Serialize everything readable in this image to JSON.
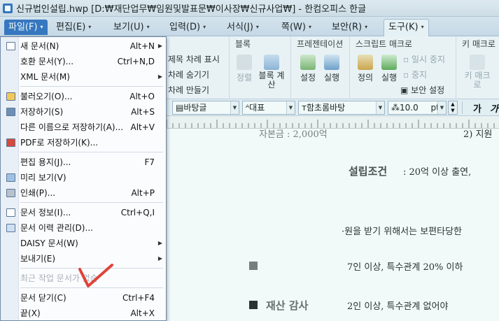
{
  "window": {
    "title": "신규법인설립.hwp [D:₩재단업무₩임원및발표문₩이사장₩신규사업₩] - 한컴오피스 한글"
  },
  "menubar": {
    "items": [
      {
        "label": "파일(F)",
        "arrow": "▾"
      },
      {
        "label": "편집(E)",
        "arrow": "▾"
      },
      {
        "label": "보기(U)",
        "arrow": "▾"
      },
      {
        "label": "입력(D)",
        "arrow": "▾"
      },
      {
        "label": "서식(J)",
        "arrow": "▾"
      },
      {
        "label": "쪽(W)",
        "arrow": "▾"
      },
      {
        "label": "보안(R)",
        "arrow": "▾"
      },
      {
        "label": "도구(K)",
        "arrow": "▾"
      }
    ]
  },
  "ribbon": {
    "toc": {
      "items": [
        "제목 차례 표시",
        "차례 숨기기",
        "차례 만들기"
      ]
    },
    "block": {
      "title": "블록",
      "buttons": [
        "정렬",
        "블록 계산"
      ]
    },
    "presentation": {
      "title": "프레젠테이션",
      "buttons": [
        "설정",
        "실행"
      ]
    },
    "script": {
      "title": "스크립트 매크로",
      "buttons": [
        "정의",
        "실행"
      ],
      "small": [
        "일시 중지",
        "중지",
        "보안 설정"
      ]
    },
    "keymacro": {
      "title": "키 매크로",
      "button": "키 매크로"
    }
  },
  "format_bar": {
    "style": "바탕글",
    "lang": "대표",
    "font": "함초롬바탕",
    "size": "10.0",
    "unit": "pt",
    "bold_glyph": "가",
    "italic_glyph": "가"
  },
  "document": {
    "lines": [
      "자본금 : 2,000억",
      "2) 지원",
      "설립조건",
      ": 20억 이상 출연,",
      "·원을 받기 위해서는 보편타당한",
      "7인 이상, 특수관계 20% 이하",
      "재산 감사",
      "2인 이상, 특수관계 없어야"
    ]
  },
  "file_menu": {
    "items": [
      {
        "label": "새 문서(N)",
        "shortcut": "Alt+N",
        "submenu": true,
        "icon": "new-document-icon",
        "disabled": false
      },
      {
        "label": "호환 문서(Y)...",
        "shortcut": "Ctrl+N,D",
        "submenu": false,
        "icon": "",
        "disabled": false
      },
      {
        "label": "XML 문서(M)",
        "shortcut": "",
        "submenu": true,
        "icon": "",
        "disabled": false
      },
      {
        "label": "불러오기(O)...",
        "shortcut": "Alt+O",
        "submenu": false,
        "icon": "open-folder-icon",
        "disabled": false
      },
      {
        "label": "저장하기(S)",
        "shortcut": "Alt+S",
        "submenu": false,
        "icon": "save-icon",
        "disabled": false
      },
      {
        "label": "다른 이름으로 저장하기(A)...",
        "shortcut": "Alt+V",
        "submenu": false,
        "icon": "",
        "disabled": false
      },
      {
        "label": "PDF로 저장하기(K)...",
        "shortcut": "",
        "submenu": false,
        "icon": "pdf-icon",
        "disabled": false
      },
      {
        "label": "편집 용지(J)...",
        "shortcut": "F7",
        "submenu": false,
        "icon": "",
        "disabled": false
      },
      {
        "label": "미리 보기(V)",
        "shortcut": "",
        "submenu": false,
        "icon": "preview-icon",
        "disabled": false
      },
      {
        "label": "인쇄(P)...",
        "shortcut": "Alt+P",
        "submenu": false,
        "icon": "print-icon",
        "disabled": false
      },
      {
        "label": "문서 정보(I)...",
        "shortcut": "Ctrl+Q,I",
        "submenu": false,
        "icon": "document-info-icon",
        "disabled": false
      },
      {
        "label": "문서 이력 관리(D)...",
        "shortcut": "",
        "submenu": false,
        "icon": "history-icon",
        "disabled": false
      },
      {
        "label": "DAISY 문서(W)",
        "shortcut": "",
        "submenu": true,
        "icon": "",
        "disabled": false
      },
      {
        "label": "보내기(E)",
        "shortcut": "",
        "submenu": true,
        "icon": "",
        "disabled": false
      },
      {
        "label": "최근 작업 문서가 없습",
        "shortcut": "",
        "submenu": false,
        "icon": "",
        "disabled": true
      },
      {
        "label": "문서 닫기(C)",
        "shortcut": "Ctrl+F4",
        "submenu": false,
        "icon": "",
        "disabled": false
      },
      {
        "label": "끝(X)",
        "shortcut": "Alt+X",
        "submenu": false,
        "icon": "",
        "disabled": false
      }
    ]
  },
  "colors": {
    "accent": "#2f6fbf",
    "annotation_check": "#e0433b"
  }
}
